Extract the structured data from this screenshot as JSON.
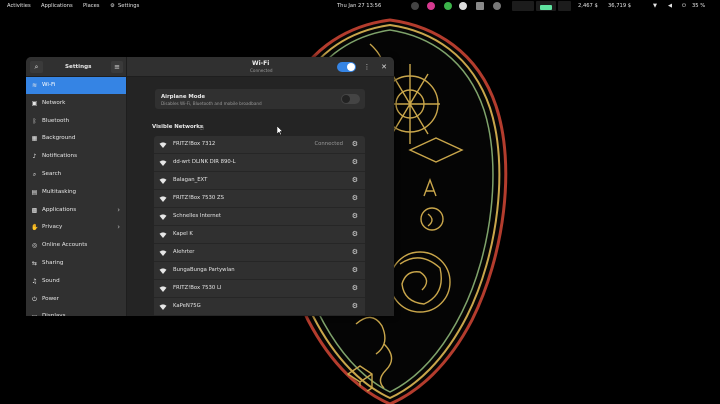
{
  "topbar": {
    "activities": "Activities",
    "applications": "Applications",
    "places": "Places",
    "settings": "Settings",
    "clock": "Thu Jan 27  13:56",
    "price1": "2,467 $",
    "price2": "36,719 $",
    "battery": "35 %"
  },
  "window": {
    "sidebar_title": "Settings",
    "title": "Wi-Fi",
    "subtitle": "Connected",
    "wifi_enabled": true
  },
  "sidebar": {
    "items": [
      {
        "label": "Wi-Fi",
        "icon": "wifi-icon",
        "glyph": "≋",
        "active": true
      },
      {
        "label": "Network",
        "icon": "network-icon",
        "glyph": "▣"
      },
      {
        "label": "Bluetooth",
        "icon": "bluetooth-icon",
        "glyph": "ᛒ"
      },
      {
        "label": "Background",
        "icon": "background-icon",
        "glyph": "▦"
      },
      {
        "label": "Notifications",
        "icon": "bell-icon",
        "glyph": "♪"
      },
      {
        "label": "Search",
        "icon": "search-icon",
        "glyph": "⌕"
      },
      {
        "label": "Multitasking",
        "icon": "multitasking-icon",
        "glyph": "▤"
      },
      {
        "label": "Applications",
        "icon": "applications-icon",
        "glyph": "▩",
        "chevron": true
      },
      {
        "label": "Privacy",
        "icon": "privacy-icon",
        "glyph": "✋",
        "chevron": true
      },
      {
        "label": "Online Accounts",
        "icon": "online-accounts-icon",
        "glyph": "◎"
      },
      {
        "label": "Sharing",
        "icon": "sharing-icon",
        "glyph": "⇆"
      },
      {
        "label": "Sound",
        "icon": "sound-icon",
        "glyph": "♫"
      },
      {
        "label": "Power",
        "icon": "power-icon",
        "glyph": "⏻"
      },
      {
        "label": "Displays",
        "icon": "display-icon",
        "glyph": "▭"
      }
    ]
  },
  "airplane": {
    "title": "Airplane Mode",
    "description": "Disables Wi-Fi, Bluetooth and mobile broadband",
    "enabled": false
  },
  "visible_networks_heading": "Visible Networks",
  "networks": [
    {
      "name": "FRITZ!Box 7312",
      "status": "Connected"
    },
    {
      "name": "dd-wrt DLINK DIR 890-L",
      "status": ""
    },
    {
      "name": "Balagan_EXT",
      "status": ""
    },
    {
      "name": "FRITZ!Box 7530 ZS",
      "status": ""
    },
    {
      "name": "Schnelles Internet",
      "status": ""
    },
    {
      "name": "Kapel K",
      "status": ""
    },
    {
      "name": "Alehrter",
      "status": ""
    },
    {
      "name": "BungaBunga Partywlan",
      "status": ""
    },
    {
      "name": "FRITZ!Box 7530 LI",
      "status": ""
    },
    {
      "name": "KaPeN75G",
      "status": ""
    }
  ],
  "colors": {
    "accent": "#3584e4",
    "window_bg": "#242424",
    "card_bg": "#303030",
    "emblem_gold": "#c9a64b",
    "emblem_green": "#7fa36b",
    "emblem_red": "#b33c2d"
  }
}
